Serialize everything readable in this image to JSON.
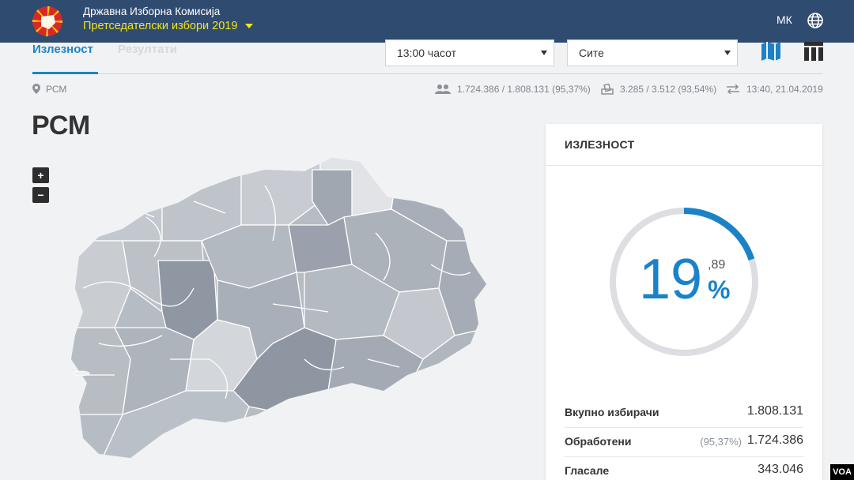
{
  "header": {
    "commission": "Државна Изборна Комисија",
    "election": "Претседателски избори 2019",
    "language": "МК"
  },
  "tabs": [
    {
      "label": "Излезност",
      "active": true
    },
    {
      "label": "Резултати",
      "active": false
    }
  ],
  "filters": {
    "time_selected": "13:00 часот",
    "region_selected": "Сите"
  },
  "location": "РСМ",
  "stats": {
    "voters": "1.724.386 / 1.808.131 (95,37%)",
    "stations": "3.285 / 3.512 (93,54%)",
    "updated": "13:40, 21.04.2019"
  },
  "page_title": "РСМ",
  "map_controls": {
    "zoom_in": "+",
    "zoom_out": "−"
  },
  "card": {
    "title": "ИЗЛЕЗНОСТ",
    "turnout_int": "19",
    "turnout_dec": ",89",
    "turnout_pct": "%",
    "turnout_fraction": 0.1989,
    "rows": {
      "total_label": "Вкупно избирачи",
      "total_value": "1.808.131",
      "processed_label": "Обработени",
      "processed_sub": "(95,37%)",
      "processed_value": "1.724.386",
      "voted_label": "Гласале",
      "voted_value": "343.046"
    }
  },
  "watermark": "VOA",
  "colors": {
    "header_bg": "#2f4b70",
    "accent": "#1a83c8",
    "election_yellow": "#f4e61a"
  },
  "icons": {
    "globe": "globe-icon",
    "map": "map-icon",
    "table": "table-icon",
    "pin": "location-pin-icon",
    "people": "people-icon",
    "ballot": "ballot-box-icon",
    "sync": "sync-arrows-icon"
  }
}
